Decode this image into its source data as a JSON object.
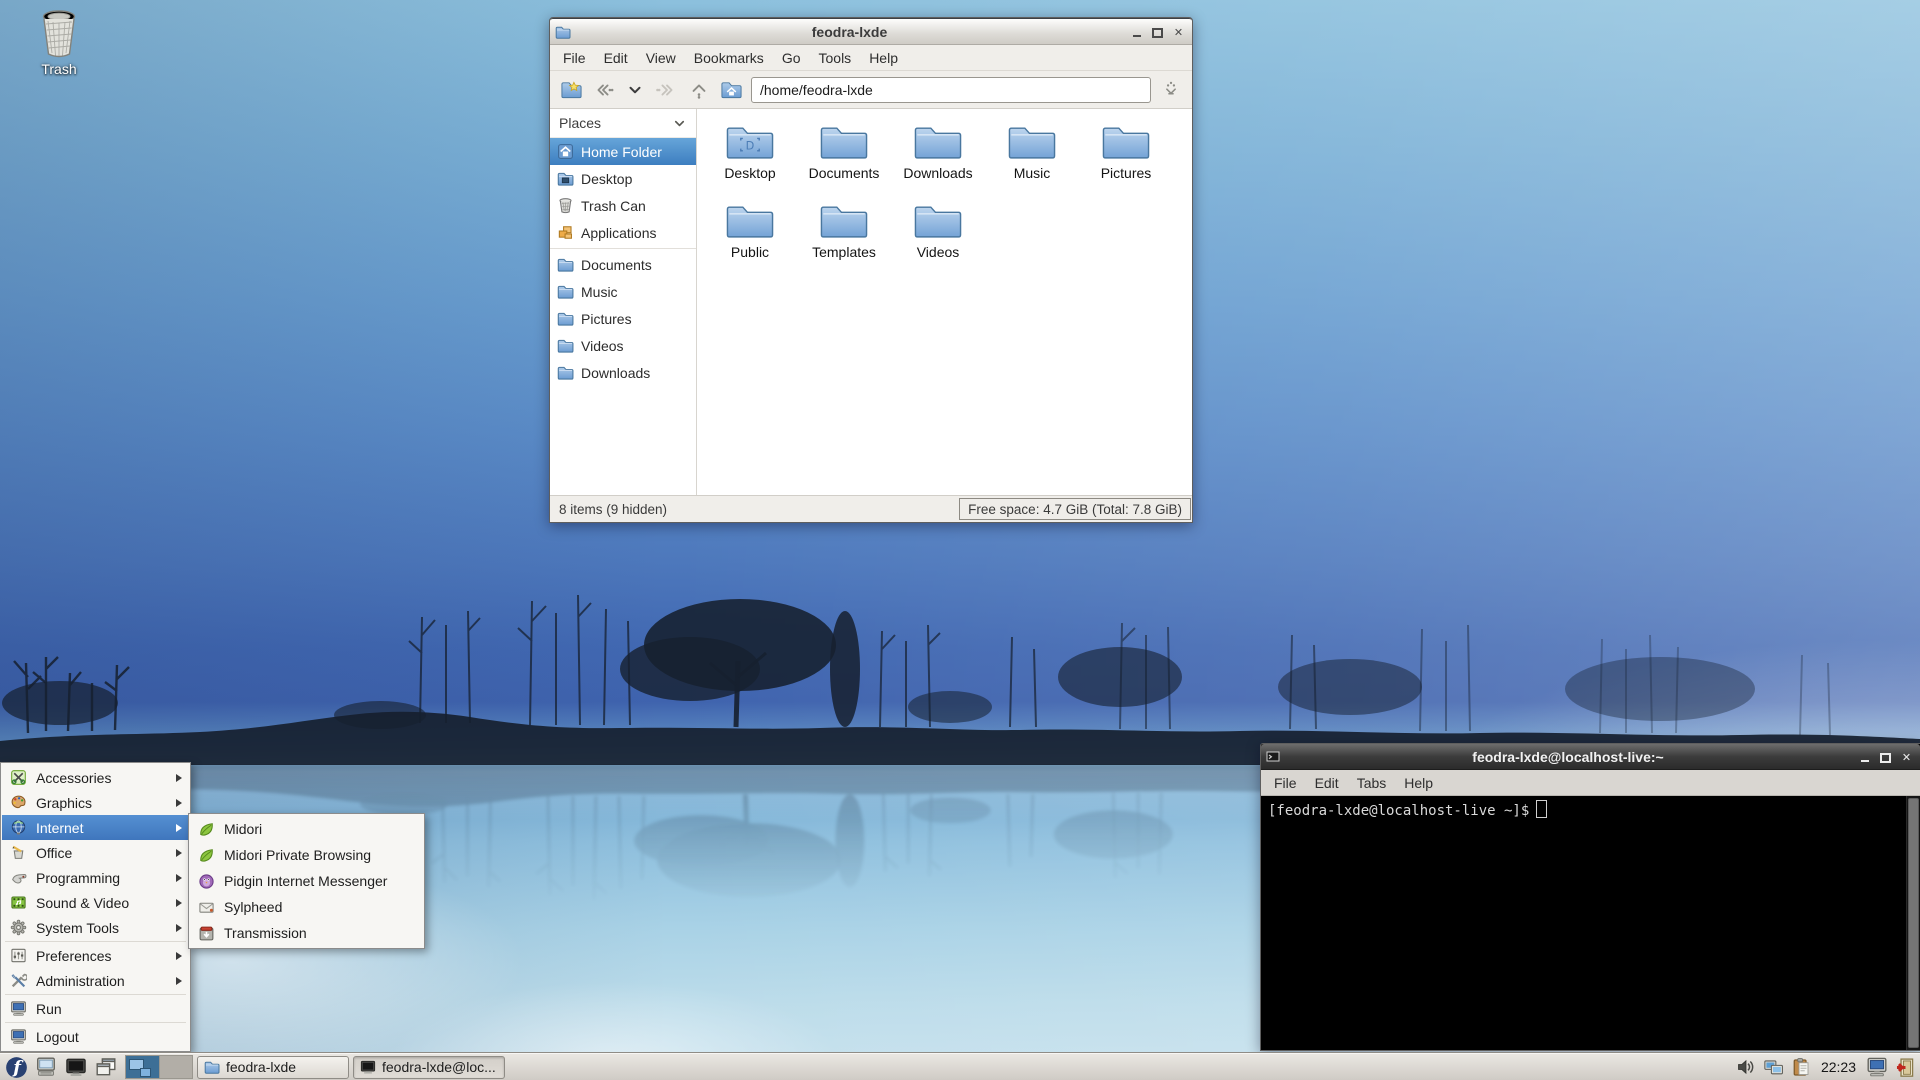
{
  "desktop": {
    "trash_label": "Trash"
  },
  "file_manager": {
    "window_title": "feodra-lxde",
    "menubar": [
      "File",
      "Edit",
      "View",
      "Bookmarks",
      "Go",
      "Tools",
      "Help"
    ],
    "address": "/home/feodra-lxde",
    "sidebar": {
      "header": "Places",
      "items": [
        {
          "label": "Home Folder",
          "icon": "home-icon",
          "selected": true
        },
        {
          "label": "Desktop",
          "icon": "desktop-folder-icon"
        },
        {
          "label": "Trash Can",
          "icon": "trash-icon"
        },
        {
          "label": "Applications",
          "icon": "applications-icon"
        },
        {
          "label": "Documents",
          "icon": "folder-icon"
        },
        {
          "label": "Music",
          "icon": "folder-icon"
        },
        {
          "label": "Pictures",
          "icon": "folder-icon"
        },
        {
          "label": "Videos",
          "icon": "folder-icon"
        },
        {
          "label": "Downloads",
          "icon": "folder-icon"
        }
      ]
    },
    "folders": [
      {
        "name": "Desktop"
      },
      {
        "name": "Documents"
      },
      {
        "name": "Downloads"
      },
      {
        "name": "Music"
      },
      {
        "name": "Pictures"
      },
      {
        "name": "Public"
      },
      {
        "name": "Templates"
      },
      {
        "name": "Videos"
      }
    ],
    "status_left": "8 items (9 hidden)",
    "status_right": "Free space: 4.7 GiB (Total: 7.8 GiB)"
  },
  "terminal": {
    "window_title": "feodra-lxde@localhost-live:~",
    "menubar": [
      "File",
      "Edit",
      "Tabs",
      "Help"
    ],
    "prompt": "[feodra-lxde@localhost-live ~]$"
  },
  "app_menu": {
    "items": [
      {
        "label": "Accessories",
        "icon": "accessories-icon",
        "has_submenu": true
      },
      {
        "label": "Graphics",
        "icon": "graphics-icon",
        "has_submenu": true
      },
      {
        "label": "Internet",
        "icon": "internet-icon",
        "has_submenu": true,
        "selected": true
      },
      {
        "label": "Office",
        "icon": "office-icon",
        "has_submenu": true
      },
      {
        "label": "Programming",
        "icon": "programming-icon",
        "has_submenu": true
      },
      {
        "label": "Sound & Video",
        "icon": "sound-video-icon",
        "has_submenu": true
      },
      {
        "label": "System Tools",
        "icon": "system-tools-icon",
        "has_submenu": true
      },
      {
        "label": "Preferences",
        "icon": "preferences-icon",
        "has_submenu": true
      },
      {
        "label": "Administration",
        "icon": "administration-icon",
        "has_submenu": true
      },
      {
        "label": "Run",
        "icon": "run-icon"
      },
      {
        "label": "Logout",
        "icon": "logout-icon"
      }
    ]
  },
  "internet_submenu": {
    "items": [
      {
        "label": "Midori",
        "icon": "midori-icon"
      },
      {
        "label": "Midori Private Browsing",
        "icon": "midori-icon"
      },
      {
        "label": "Pidgin Internet Messenger",
        "icon": "pidgin-icon"
      },
      {
        "label": "Sylpheed",
        "icon": "sylpheed-icon"
      },
      {
        "label": "Transmission",
        "icon": "transmission-icon"
      }
    ]
  },
  "taskbar": {
    "start_logo": "f",
    "tasks": [
      {
        "label": "feodra-lxde",
        "icon": "folder-icon"
      },
      {
        "label": "feodra-lxde@loc...",
        "icon": "terminal-icon"
      }
    ],
    "clock": "22:23"
  },
  "colors": {
    "selection_blue": "#4a82c8",
    "folder_blue": "#7aa7d8",
    "taskbar_gray": "#d6d2cc",
    "terminal_black": "#000000"
  }
}
